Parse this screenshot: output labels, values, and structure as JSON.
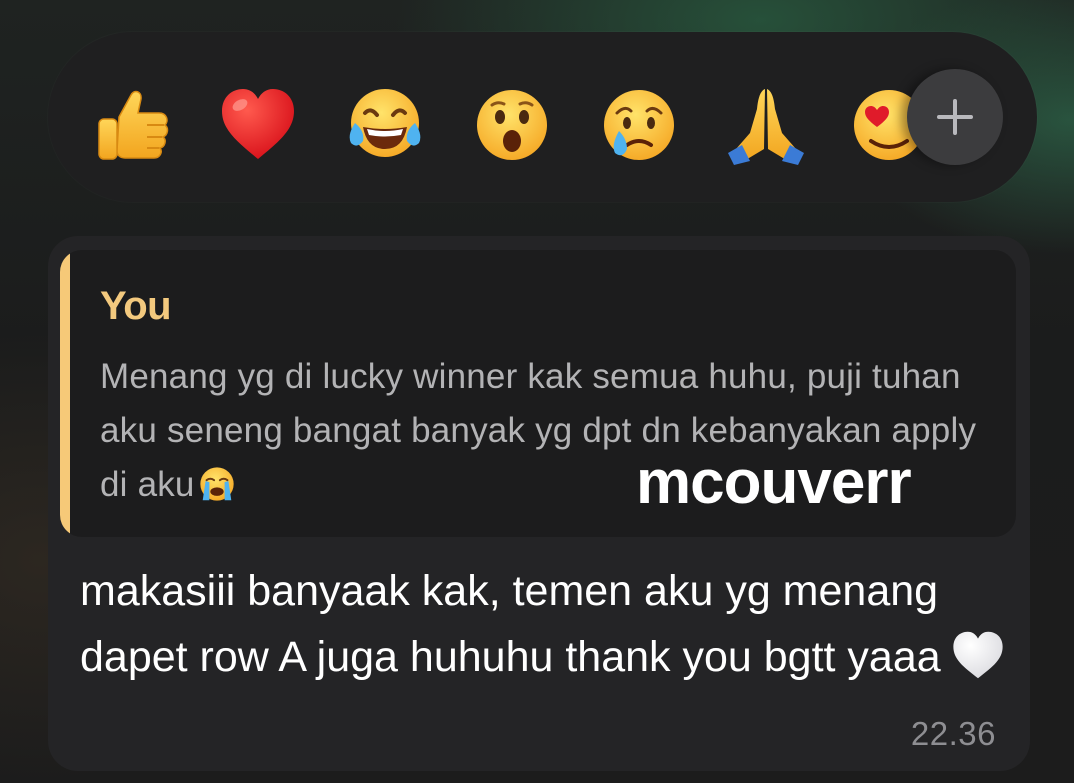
{
  "reactions": [
    {
      "icon": "thumbs-up-icon",
      "glyph": "👍"
    },
    {
      "icon": "red-heart-icon",
      "glyph": "❤️"
    },
    {
      "icon": "face-with-tears-of-joy-icon",
      "glyph": "😂"
    },
    {
      "icon": "face-with-open-mouth-icon",
      "glyph": "😮"
    },
    {
      "icon": "crying-face-icon",
      "glyph": "😢"
    },
    {
      "icon": "folded-hands-icon",
      "glyph": "🙏"
    },
    {
      "icon": "heart-eyes-icon",
      "glyph": "😍"
    }
  ],
  "more_reactions_icon": "plus-icon",
  "message": {
    "quote": {
      "author": "You",
      "text": "Menang yg di lucky winner kak semua huhu, puji tuhan aku seneng bangat banyak yg dpt dn kebanyakan apply di aku",
      "emoji": "😭",
      "accent": "#f6c978"
    },
    "watermark": "mcouverr",
    "text": "makasiii banyaak kak, temen aku yg menang dapet row A juga huhuhu thank you bgtt yaaa",
    "emoji": "🤍",
    "time": "22.36"
  }
}
